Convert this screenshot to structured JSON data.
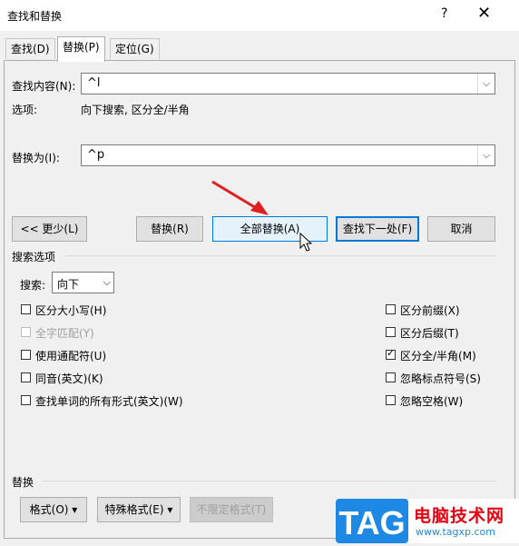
{
  "window": {
    "title": "查找和替换",
    "help": "?",
    "close": "✕"
  },
  "tabs": [
    {
      "label": "查找(D)",
      "active": false
    },
    {
      "label": "替换(P)",
      "active": true
    },
    {
      "label": "定位(G)",
      "active": false
    }
  ],
  "find": {
    "label": "查找内容(N):",
    "value": "^l"
  },
  "options_row": {
    "label": "选项:",
    "value": "向下搜索, 区分全/半角"
  },
  "replace": {
    "label": "替换为(I):",
    "value": "^p"
  },
  "buttons": {
    "less": "<< 更少(L)",
    "replace": "替换(R)",
    "replace_all": "全部替换(A)",
    "find_next": "查找下一处(F)",
    "cancel": "取消"
  },
  "search_options": {
    "heading": "搜索选项",
    "search_label": "搜索:",
    "search_value": "向下",
    "left": [
      {
        "label": "区分大小写(H)",
        "checked": false,
        "disabled": false
      },
      {
        "label": "全字匹配(Y)",
        "checked": false,
        "disabled": true
      },
      {
        "label": "使用通配符(U)",
        "checked": false,
        "disabled": false
      },
      {
        "label": "同音(英文)(K)",
        "checked": false,
        "disabled": false
      },
      {
        "label": "查找单词的所有形式(英文)(W)",
        "checked": false,
        "disabled": false
      }
    ],
    "right": [
      {
        "label": "区分前缀(X)",
        "checked": false
      },
      {
        "label": "区分后缀(T)",
        "checked": false
      },
      {
        "label": "区分全/半角(M)",
        "checked": true
      },
      {
        "label": "忽略标点符号(S)",
        "checked": false
      },
      {
        "label": "忽略空格(W)",
        "checked": false
      }
    ]
  },
  "replace_section": {
    "heading": "替换",
    "format": "格式(O) ▾",
    "special": "特殊格式(E) ▾",
    "no_format": "不限定格式(T)"
  },
  "watermark": {
    "logo": "TAG",
    "site_name": "电脑技术网",
    "url": "www.tagxp.com"
  },
  "colors": {
    "accent": "#0078d7",
    "arrow": "#e02020",
    "tag_blue": "#1e88e5",
    "site_red": "#e60012"
  }
}
